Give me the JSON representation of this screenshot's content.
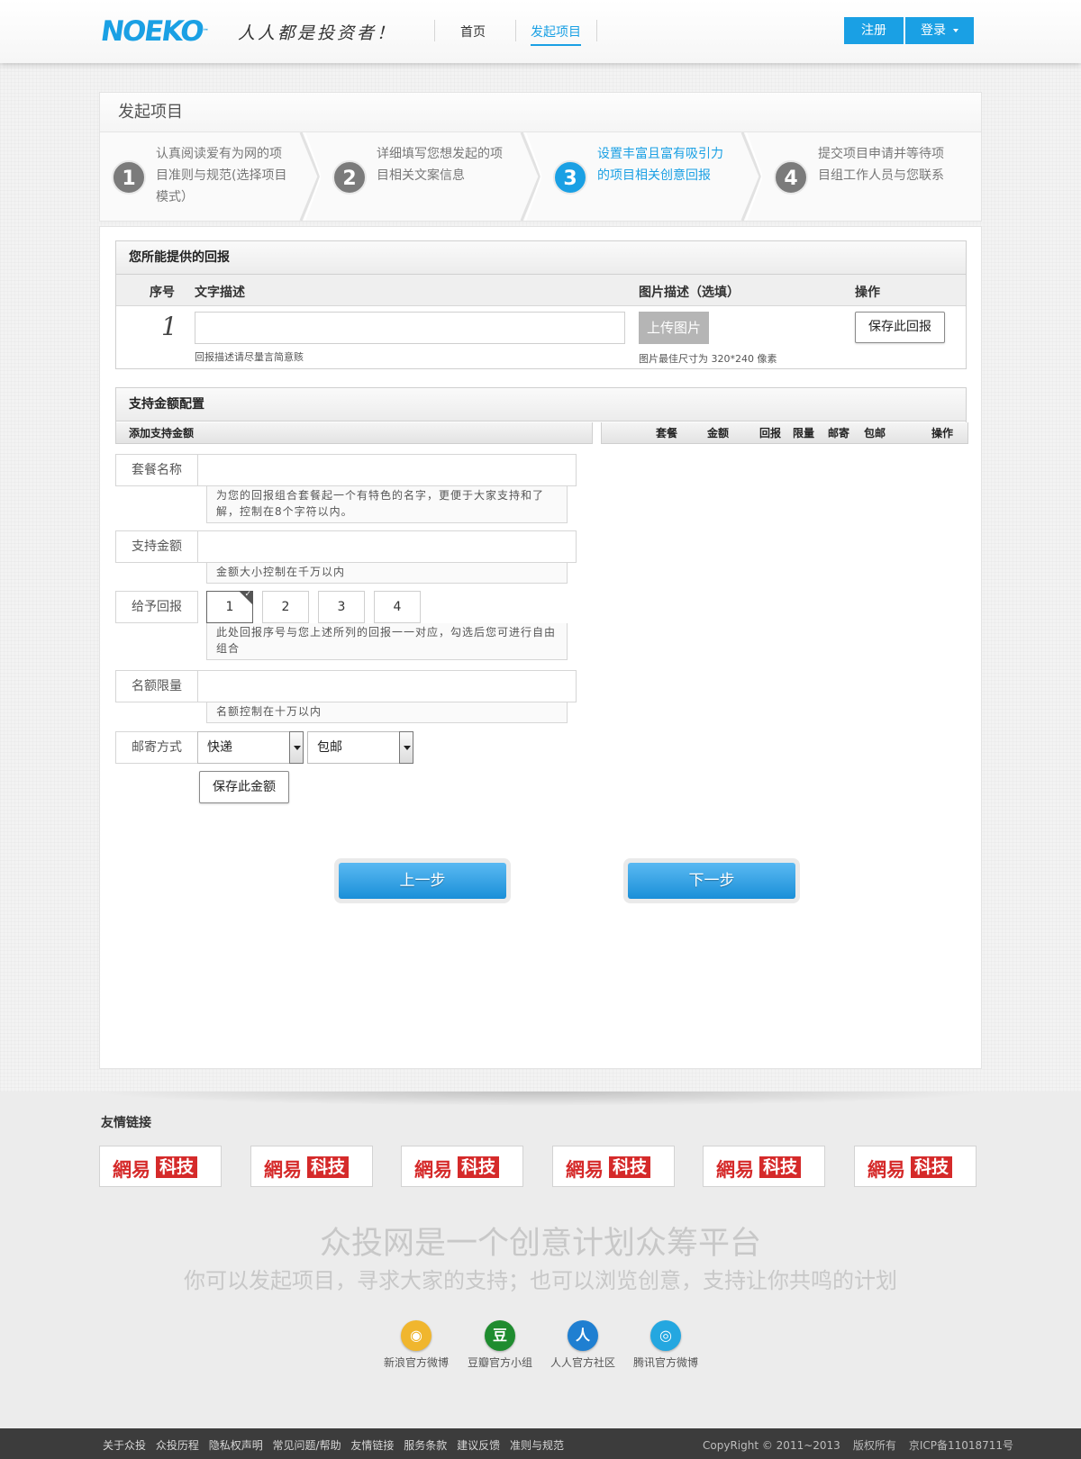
{
  "header": {
    "logo": "NOEKO",
    "logo_tm": "™",
    "slogan": "人人都是投资者！",
    "nav": [
      "首页",
      "发起项目"
    ],
    "register": "注册",
    "login": "登录"
  },
  "title_panel": {
    "title": "发起项目",
    "steps": [
      {
        "num": "1",
        "text": "认真阅读爱有为网的项目准则与规范(选择项目模式）"
      },
      {
        "num": "2",
        "text": "详细填写您想发起的项目相关文案信息"
      },
      {
        "num": "3",
        "text": "设置丰富且富有吸引力的项目相关创意回报"
      },
      {
        "num": "4",
        "text": "提交项目申请并等待项目组工作人员与您联系"
      }
    ]
  },
  "reward_section": {
    "title": "您所能提供的回报",
    "columns": [
      "序号",
      "文字描述",
      "图片描述（选填）",
      "操作"
    ],
    "row_index": "1",
    "text_hint": "回报描述请尽量言简意赅",
    "upload_label": "上传图片",
    "image_hint": "图片最佳尺寸为 320*240 像素",
    "save_label": "保存此回报"
  },
  "amount_section": {
    "title": "支持金额配置",
    "add_label": "添加支持金额",
    "table_columns": [
      "套餐",
      "金额",
      "回报",
      "限量",
      "邮寄",
      "包邮",
      "操作"
    ],
    "fields": {
      "package_name": {
        "label": "套餐名称",
        "hint": "为您的回报组合套餐起一个有特色的名字，更便于大家支持和了解，控制在8个字符以内。"
      },
      "amount": {
        "label": "支持金额",
        "hint": "金额大小控制在千万以内"
      },
      "reward": {
        "label": "给予回报",
        "options": [
          "1",
          "2",
          "3",
          "4"
        ],
        "hint": "此处回报序号与您上述所列的回报一一对应，勾选后您可进行自由组合"
      },
      "limit": {
        "label": "名额限量",
        "hint": "名额控制在十万以内"
      },
      "shipping": {
        "label": "邮寄方式",
        "method": "快递",
        "fee": "包邮"
      }
    },
    "save_label": "保存此金额"
  },
  "nav_buttons": {
    "prev": "上一步",
    "next": "下一步"
  },
  "footer": {
    "links_title": "友情链接",
    "link_logo_a": "網易",
    "link_logo_b": "科技",
    "slogan_1": "众投网是一个创意计划众筹平台",
    "slogan_2": "你可以发起项目，寻求大家的支持；也可以浏览创意，支持让你共鸣的计划",
    "social": [
      {
        "label": "新浪官方微博",
        "glyph": "◉",
        "color": "#f0b62e"
      },
      {
        "label": "豆瓣官方小组",
        "glyph": "豆",
        "color": "#1f8c2f"
      },
      {
        "label": "人人官方社区",
        "glyph": "人",
        "color": "#1f7fd1"
      },
      {
        "label": "腾讯官方微博",
        "glyph": "◎",
        "color": "#24a7e0"
      }
    ],
    "bottom_links": [
      "关于众投",
      "众投历程",
      "隐私权声明",
      "常见问题/帮助",
      "友情链接",
      "服务条款",
      "建议反馈",
      "准则与规范"
    ],
    "copyright": "CopyRight © 2011~2013",
    "rights": "版权所有",
    "icp": "京ICP备11018711号"
  }
}
